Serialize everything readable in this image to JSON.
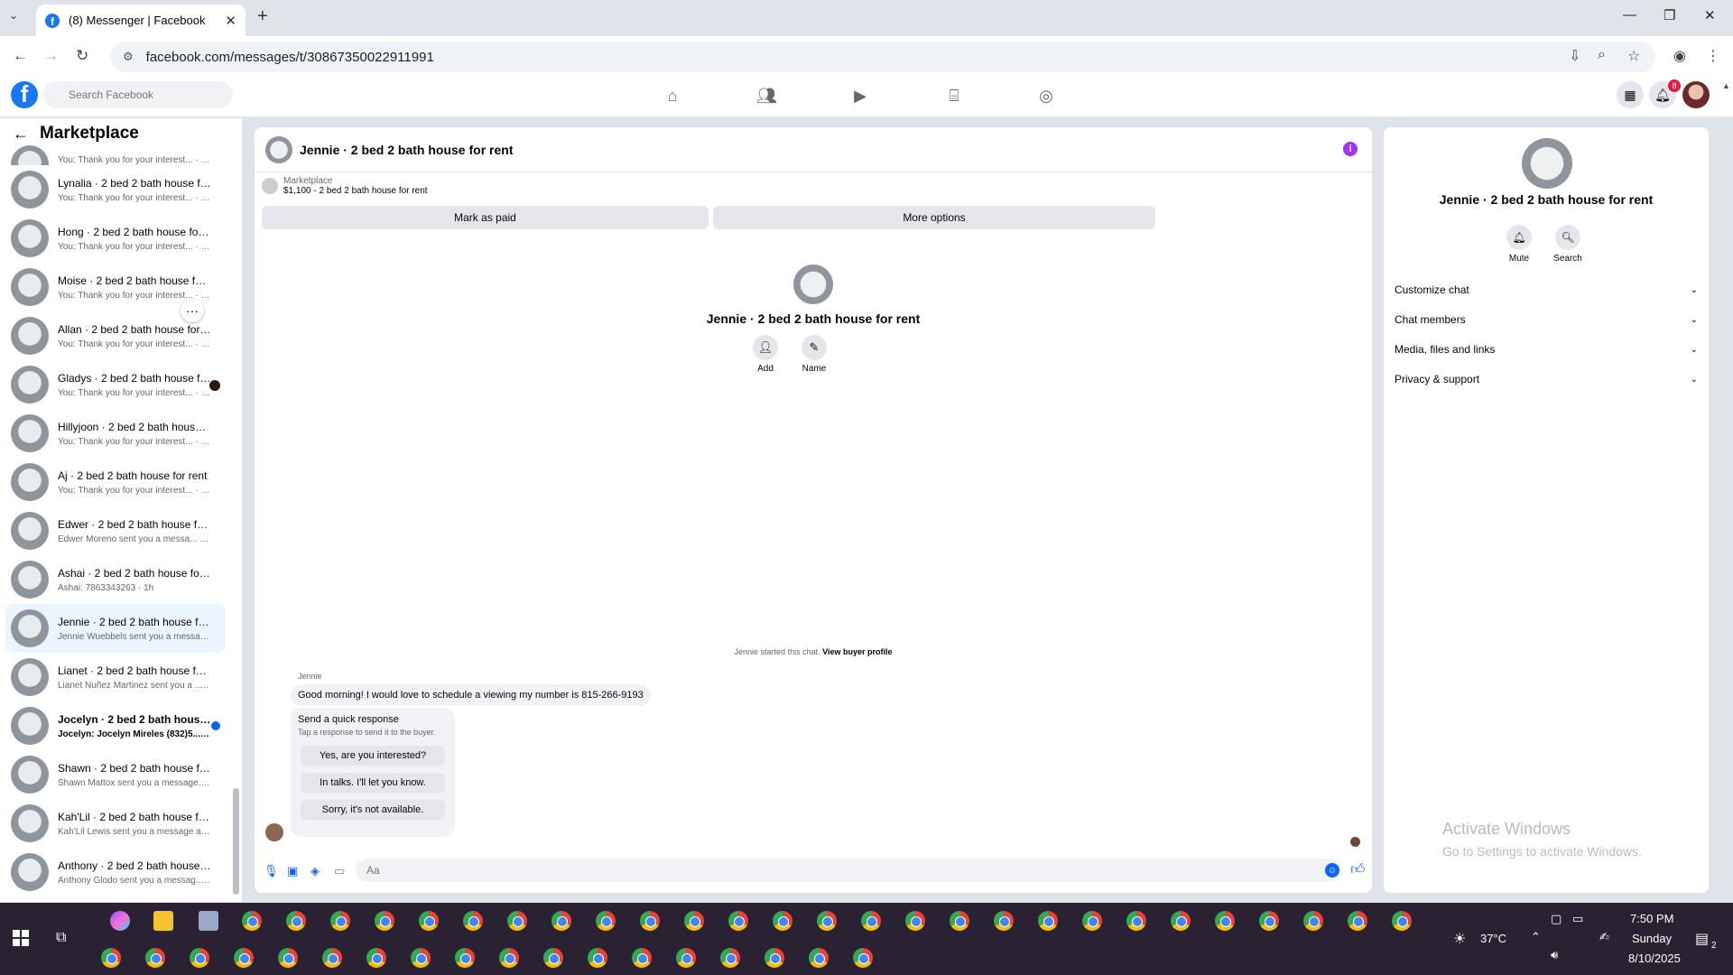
{
  "browser": {
    "tab_title": "(8) Messenger | Facebook",
    "favicon_letter": "f",
    "url": "facebook.com/messages/t/30867350022911991"
  },
  "fb": {
    "logo_letter": "f",
    "search_placeholder": "Search Facebook",
    "notification_count": "8"
  },
  "sidebar": {
    "title": "Marketplace",
    "top_partial_sub": "You: Thank you for your interest... · 39m",
    "conversations": [
      {
        "name": "Lynalia · 2 bed 2 bath house for rent",
        "sub": "You: Thank you for your interest... · 39m"
      },
      {
        "name": "Hong · 2 bed 2 bath house for rent",
        "sub": "You: Thank you for your interest... · 39m"
      },
      {
        "name": "Moise · 2 bed 2 bath house for rent",
        "sub": "You: Thank you for your interest... · 39m"
      },
      {
        "name": "Allan · 2 bed 2 bath house for rent",
        "sub": "You: Thank you for your interest... · 39m"
      },
      {
        "name": "Gladys · 2 bed 2 bath house for rent",
        "sub": "You: Thank you for your interest... · 39m"
      },
      {
        "name": "Hillyjoon · 2 bed 2 bath house for rent",
        "sub": "You: Thank you for your interest... · 39m"
      },
      {
        "name": "Aj · 2 bed 2 bath house for rent",
        "sub": "You: Thank you for your interest... · 39m"
      },
      {
        "name": "Edwer · 2 bed 2 bath house for rent",
        "sub": "Edwer Moreno sent you a messa... · 47m"
      },
      {
        "name": "Ashai · 2 bed 2 bath house for rent",
        "sub": "Ashai: 7863343263 · 1h"
      },
      {
        "name": "Jennie · 2 bed 2 bath house for rent",
        "sub": "Jennie Wuebbels sent you a messa... · 1h"
      },
      {
        "name": "Lianet · 2 bed 2 bath house for rent",
        "sub": "Lianet Nuñez Martinez sent you a ... · 1h"
      },
      {
        "name": "Jocelyn · 2 bed 2 bath house for rent",
        "sub": "Jocelyn: Jocelyn Mireles (832)5... · 4h"
      },
      {
        "name": "Shawn · 2 bed 2 bath house for rent",
        "sub": "Shawn Mattox sent you a message... · 7h"
      },
      {
        "name": "Kah'Lil · 2 bed 2 bath house for rent",
        "sub": "Kah'Lil Lewis sent you a message a... · 8h"
      },
      {
        "name": "Anthony · 2 bed 2 bath house for rent",
        "sub": "Anthony Glodo sent you a messag... · 8h"
      }
    ],
    "more_label": "···"
  },
  "chat": {
    "title": "Jennie · 2 bed 2 bath house for rent",
    "marketplace_label": "Marketplace",
    "listing": "$1,100 - 2 bed 2 bath house for rent",
    "mark_paid": "Mark as paid",
    "more_options": "More options",
    "profile_title": "Jennie · 2 bed 2 bath house for rent",
    "add_label": "Add",
    "name_label": "Name",
    "started_text": "Jennie started this chat.",
    "view_profile": "View buyer profile",
    "sender": "Jennie",
    "message": "Good morning! I would love to schedule a viewing my number is 815-266-9193",
    "quick_title": "Send a quick response",
    "quick_sub": "Tap a response to send it to the buyer.",
    "quick_replies": [
      "Yes, are you interested?",
      "In talks. I'll let you know.",
      "Sorry, it's not available."
    ],
    "input_placeholder": "Aa"
  },
  "rpanel": {
    "title": "Jennie · 2 bed 2 bath house for rent",
    "mute": "Mute",
    "search": "Search",
    "sections": [
      "Customize chat",
      "Chat members",
      "Media, files and links",
      "Privacy & support"
    ]
  },
  "watermark": {
    "line1": "Activate Windows",
    "line2": "Go to Settings to activate Windows."
  },
  "taskbar": {
    "temp": "37°C",
    "time": "7:50 PM",
    "day": "Sunday",
    "date": "8/10/2025",
    "notif_count": "2"
  },
  "colors": {
    "fb_blue": "#1877f2",
    "messenger_blue": "#0866ff",
    "info_purple": "#a033ff",
    "badge_red": "#e41e3f"
  }
}
